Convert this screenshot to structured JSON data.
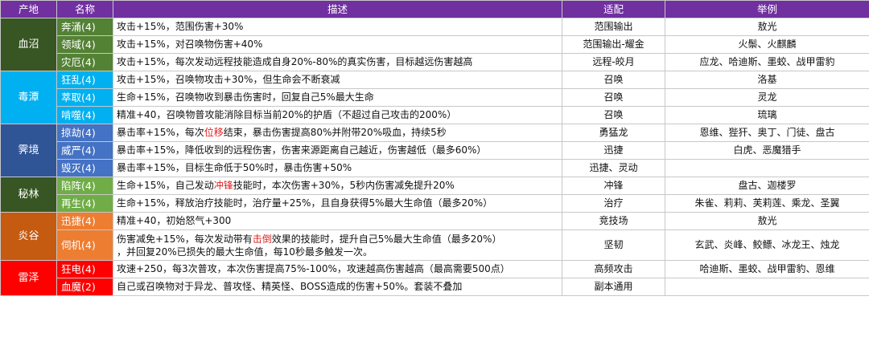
{
  "colors": {
    "header_bg": "#7030a0",
    "region_blood": "#375623",
    "name_blood": "#548235",
    "region_poison": "#00b0f0",
    "name_poison": "#00b0f0",
    "region_fog": "#2f5597",
    "name_fog": "#4472c4",
    "region_jungle": "#375623",
    "name_jungle": "#70ad47",
    "region_flame": "#c55a11",
    "name_flame": "#ed7d31",
    "region_thunder": "#ff0000",
    "name_thunder": "#ff0000",
    "highlight_text": "#e02020"
  },
  "headers": {
    "region": "产地",
    "name": "名称",
    "desc": "描述",
    "fit": "适配",
    "example": "举例"
  },
  "regions": [
    {
      "label": "血沼"
    },
    {
      "label": "毒潭"
    },
    {
      "label": "霁境"
    },
    {
      "label": "秘林"
    },
    {
      "label": "炎谷"
    },
    {
      "label": "雷泽"
    }
  ],
  "rows": [
    {
      "name": "奔涌(4)",
      "desc": "攻击+15%，范围伤害+30%",
      "fit": "范围输出",
      "example": "敖光"
    },
    {
      "name": "领域(4)",
      "desc": "攻击+15%，对召唤物伤害+40%",
      "fit": "范围输出-耀金",
      "example": "火鬃、火麒麟"
    },
    {
      "name": "灾厄(4)",
      "desc": "攻击+15%，每次发动远程技能造成自身20%-80%的真实伤害，目标越远伤害越高",
      "fit": "远程-皎月",
      "example": "应龙、哈迪斯、墨蛟、战甲雷豹"
    },
    {
      "name": "狂乱(4)",
      "desc": "攻击+15%，召唤物攻击+30%，但生命会不断衰减",
      "fit": "召唤",
      "example": "洛基"
    },
    {
      "name": "萃取(4)",
      "desc": "生命+15%，召唤物收到暴击伤害时，回复自己5%最大生命",
      "fit": "召唤",
      "example": "灵龙"
    },
    {
      "name": "啃噬(4)",
      "desc": "精准+40，召唤物普攻能消除目标当前20%的护盾（不超过自己攻击的200%）",
      "fit": "召唤",
      "example": "琉璃"
    },
    {
      "name": "掠劫(4)",
      "desc_a": "暴击率+15%，每次",
      "desc_hl": "位移",
      "desc_b": "结束，暴击伤害提高80%并附带20%吸血，持续5秒",
      "fit": "勇猛龙",
      "example": "恩维、狴犴、奥丁、门徒、盘古"
    },
    {
      "name": "威严(4)",
      "desc": "暴击率+15%，降低收到的远程伤害，伤害来源距离自己越近，伤害越低（最多60%）",
      "fit": "迅捷",
      "example": "白虎、恶魔猎手"
    },
    {
      "name": "毁灭(4)",
      "desc": "暴击率+15%，目标生命低于50%时，暴击伤害+50%",
      "fit": "迅捷、灵动",
      "example": ""
    },
    {
      "name": "陷阵(4)",
      "desc_a": "生命+15%，自己发动",
      "desc_hl": "冲锋",
      "desc_b": "技能时，本次伤害+30%，5秒内伤害减免提升20%",
      "fit": "冲锋",
      "example": "盘古、迦楼罗"
    },
    {
      "name": "再生(4)",
      "desc": "生命+15%，释放治疗技能时，治疗量+25%，且自身获得5%最大生命值（最多20%）",
      "fit": "治疗",
      "example": "朱雀、莉莉、芙莉莲、乘龙、圣翼"
    },
    {
      "name": "迅捷(4)",
      "desc": "精准+40，初始怒气+300",
      "fit": "竞技场",
      "example": "敖光"
    },
    {
      "name": "伺机(4)",
      "desc_a": "伤害减免+15%，每次发动带有",
      "desc_hl": "击倒",
      "desc_b": "效果的技能时，提升自己5%最大生命值（最多20%）",
      "desc_c": "，并回复20%已损失的最大生命值，每10秒最多触发一次。",
      "fit": "坚韧",
      "example": "玄武、炎峰、鲛鳔、冰龙王、烛龙"
    },
    {
      "name": "狂电(4)",
      "desc": "攻速+250，每3次普攻，本次伤害提高75%-100%，攻速越高伤害越高（最高需要500点）",
      "fit": "高频攻击",
      "example": "哈迪斯、墨蛟、战甲雷豹、恩维"
    },
    {
      "name": "血魔(2)",
      "desc": "自己或召唤物对于异龙、普攻怪、精英怪、BOSS造成的伤害+50%。套装不叠加",
      "fit": "副本通用",
      "example": ""
    }
  ]
}
